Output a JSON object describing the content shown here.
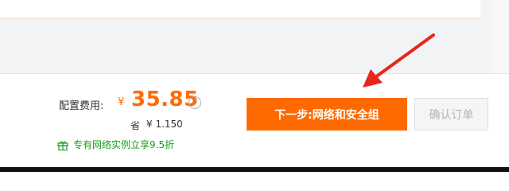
{
  "pricing": {
    "fee_label": "配置费用:",
    "currency": "¥",
    "price": "35.85",
    "help_glyph": "?",
    "save_label": "省",
    "save_value": "¥ 1.150",
    "promo_text": "专有网络实例立享9.5折"
  },
  "actions": {
    "next_label": "下一步:网络和安全组",
    "confirm_label": "确认订单"
  },
  "colors": {
    "accent": "#ff6a00",
    "promo": "#14a01f",
    "annotation": "#e8261c"
  },
  "icons": {
    "help": "question-circle-icon",
    "promo": "gift-icon",
    "annotation": "red-arrow-icon"
  }
}
